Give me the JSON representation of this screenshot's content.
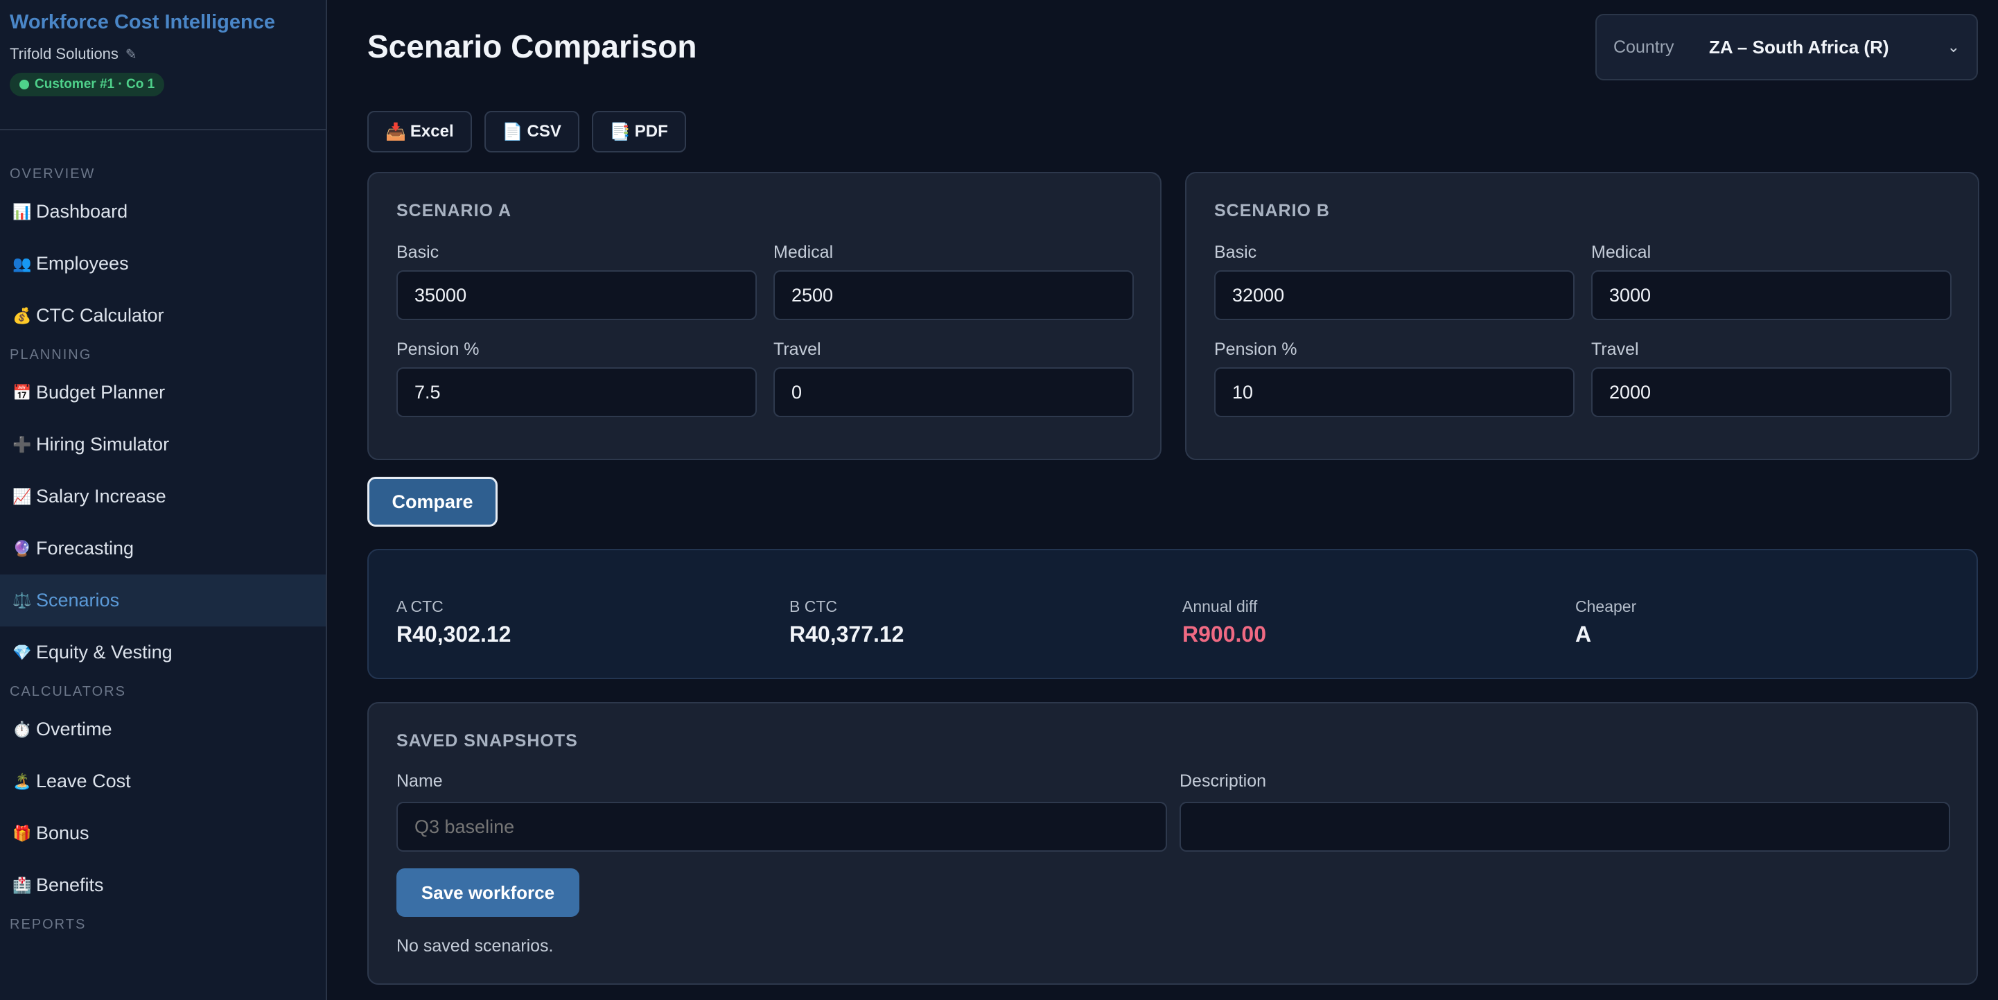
{
  "app": {
    "title": "Workforce Cost Intelligence",
    "company": "Trifold Solutions",
    "edit_icon": "pencil-icon",
    "customer_badge": "Customer #1 · Co 1",
    "badge_color": "#4fd18b"
  },
  "sidebar": {
    "sections": [
      {
        "label": "OVERVIEW",
        "items": [
          {
            "icon": "📊",
            "label": "Dashboard"
          },
          {
            "icon": "👥",
            "label": "Employees"
          },
          {
            "icon": "💰",
            "label": "CTC Calculator"
          }
        ]
      },
      {
        "label": "PLANNING",
        "items": [
          {
            "icon": "📅",
            "label": "Budget Planner"
          },
          {
            "icon": "➕",
            "label": "Hiring Simulator"
          },
          {
            "icon": "📈",
            "label": "Salary Increase"
          },
          {
            "icon": "🔮",
            "label": "Forecasting"
          },
          {
            "icon": "⚖️",
            "label": "Scenarios",
            "active": true
          },
          {
            "icon": "💎",
            "label": "Equity & Vesting"
          }
        ]
      },
      {
        "label": "CALCULATORS",
        "items": [
          {
            "icon": "⏱️",
            "label": "Overtime"
          },
          {
            "icon": "🏝️",
            "label": "Leave Cost"
          },
          {
            "icon": "🎁",
            "label": "Bonus"
          },
          {
            "icon": "🏥",
            "label": "Benefits"
          }
        ]
      },
      {
        "label": "REPORTS",
        "items": []
      }
    ],
    "accent": "#5b9ad8"
  },
  "header": {
    "title": "Scenario Comparison",
    "country_label": "Country",
    "country_value": "ZA – South Africa (R)"
  },
  "exports": [
    {
      "icon": "📥",
      "label": "Excel"
    },
    {
      "icon": "📄",
      "label": "CSV"
    },
    {
      "icon": "📑",
      "label": "PDF"
    }
  ],
  "scenario_a": {
    "title": "SCENARIO A",
    "basic_label": "Basic",
    "basic": "35000",
    "medical_label": "Medical",
    "medical": "2500",
    "pension_label": "Pension %",
    "pension": "7.5",
    "travel_label": "Travel",
    "travel": "0"
  },
  "scenario_b": {
    "title": "SCENARIO B",
    "basic_label": "Basic",
    "basic": "32000",
    "medical_label": "Medical",
    "medical": "3000",
    "pension_label": "Pension %",
    "pension": "10",
    "travel_label": "Travel",
    "travel": "2000"
  },
  "compare_label": "Compare",
  "results": {
    "a_label": "A CTC",
    "a_value": "R40,302.12",
    "b_label": "B CTC",
    "b_value": "R40,377.12",
    "diff_label": "Annual diff",
    "diff_value": "R900.00",
    "cheaper_label": "Cheaper",
    "cheaper_value": "A",
    "diff_color": "#f06a83"
  },
  "snapshots": {
    "title": "SAVED SNAPSHOTS",
    "name_label": "Name",
    "name_placeholder": "Q3 baseline",
    "description_label": "Description",
    "description_value": "",
    "save_label": "Save workforce",
    "empty_text": "No saved scenarios."
  }
}
